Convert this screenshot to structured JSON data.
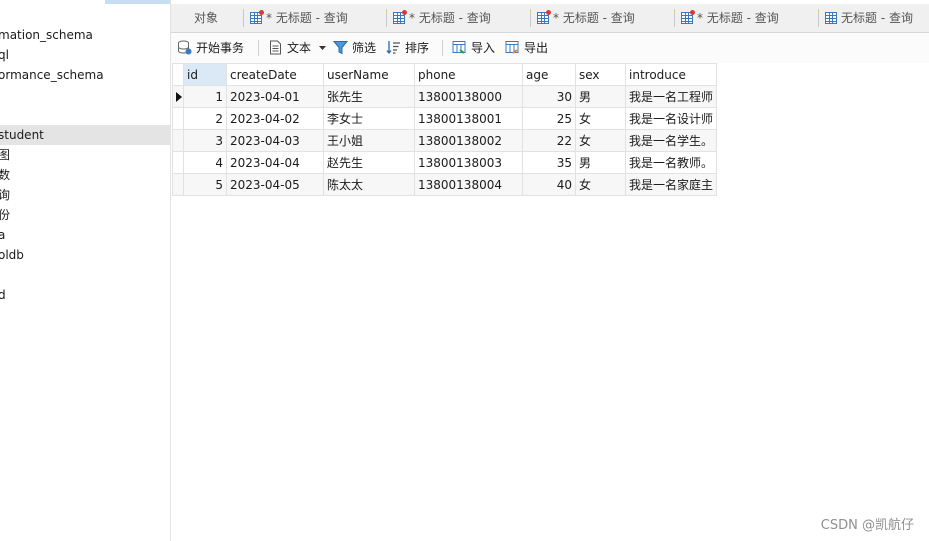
{
  "sidebar": {
    "items": [
      {
        "label": "mation_schema",
        "selected": false
      },
      {
        "label": "ql",
        "selected": false
      },
      {
        "label": "ormance_schema",
        "selected": false
      },
      {
        "label": "student",
        "selected": true
      },
      {
        "label": "图",
        "selected": false
      },
      {
        "label": "数",
        "selected": false
      },
      {
        "label": "询",
        "selected": false
      },
      {
        "label": "份",
        "selected": false
      },
      {
        "label": "a",
        "selected": false
      },
      {
        "label": "oldb",
        "selected": false
      },
      {
        "label": "d",
        "selected": false
      }
    ]
  },
  "tabs": [
    {
      "label": "对象",
      "icon": "none"
    },
    {
      "label": "* 无标题 - 查询",
      "icon": "query-table-icon"
    },
    {
      "label": "* 无标题 - 查询",
      "icon": "query-table-icon"
    },
    {
      "label": "* 无标题 - 查询",
      "icon": "query-table-icon"
    },
    {
      "label": "* 无标题 - 查询",
      "icon": "query-table-icon"
    },
    {
      "label": "无标题 - 查询",
      "icon": "query-table-icon"
    }
  ],
  "toolbar": {
    "begin_transaction": "开始事务",
    "text": "文本",
    "filter": "筛选",
    "sort": "排序",
    "import": "导入",
    "export": "导出"
  },
  "grid": {
    "columns": [
      "id",
      "createDate",
      "userName",
      "phone",
      "age",
      "sex",
      "introduce"
    ],
    "rows": [
      [
        "1",
        "2023-04-01",
        "张先生",
        "13800138000",
        "30",
        "男",
        "我是一名工程师"
      ],
      [
        "2",
        "2023-04-02",
        "李女士",
        "13800138001",
        "25",
        "女",
        "我是一名设计师"
      ],
      [
        "3",
        "2023-04-03",
        "王小姐",
        "13800138002",
        "22",
        "女",
        "我是一名学生。"
      ],
      [
        "4",
        "2023-04-04",
        "赵先生",
        "13800138003",
        "35",
        "男",
        "我是一名教师。"
      ],
      [
        "5",
        "2023-04-05",
        "陈太太",
        "13800138004",
        "40",
        "女",
        "我是一名家庭主"
      ]
    ]
  },
  "watermark": "CSDN @凯航仔",
  "colors": {
    "accent": "#3a78c2",
    "selected_row": "#e4e4e4",
    "header_selected": "#dbe8f6"
  }
}
